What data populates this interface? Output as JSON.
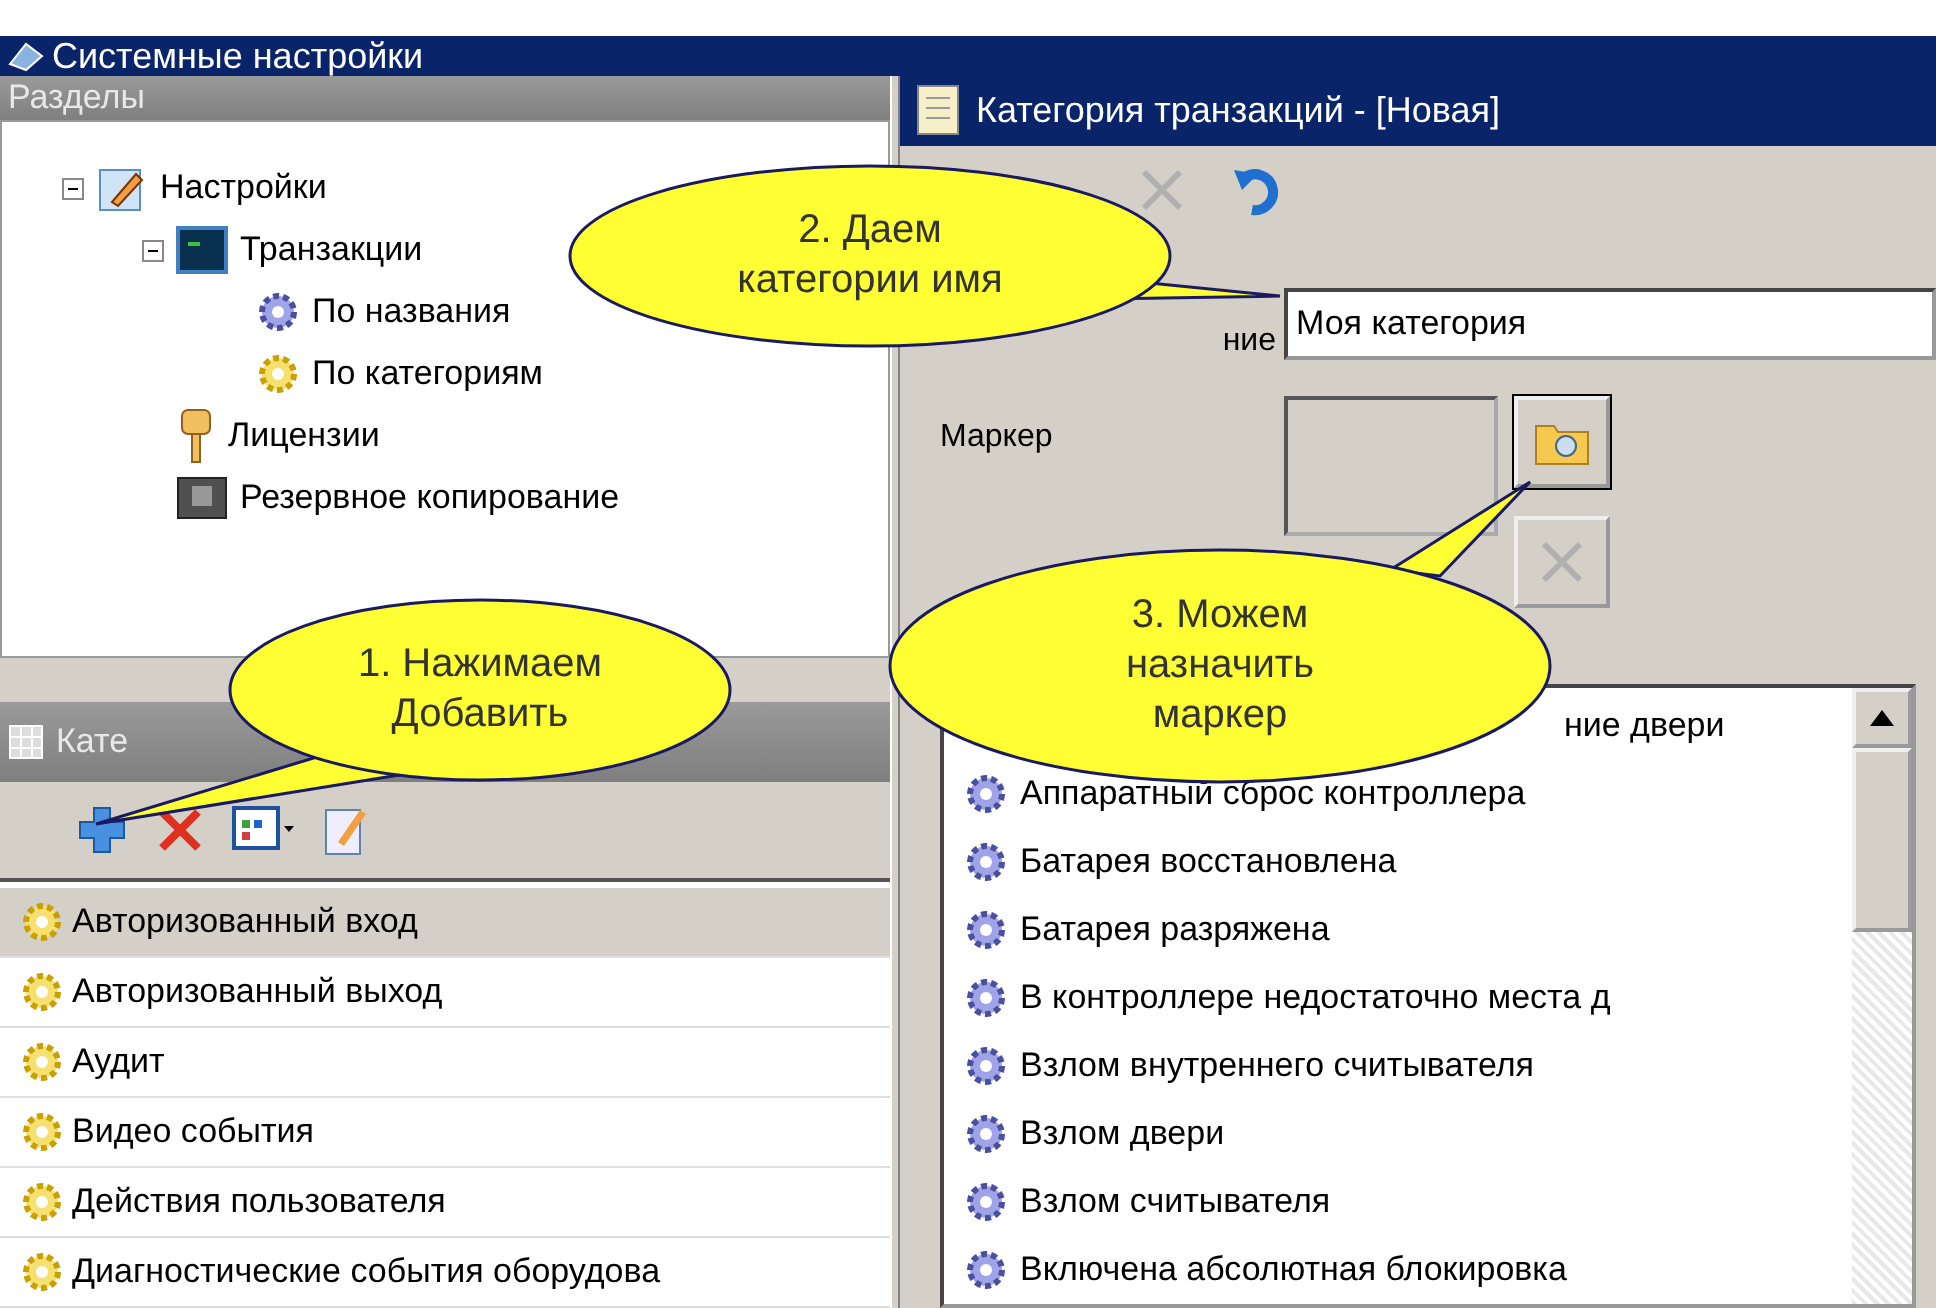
{
  "window": {
    "title": "Системные настройки"
  },
  "sections_panel": {
    "title": "Разделы",
    "tree": [
      {
        "label": "Настройки",
        "kind": "settings",
        "expanded": true,
        "children": [
          {
            "label": "Транзакции",
            "kind": "terminal",
            "expanded": true,
            "children": [
              {
                "label": "По названия",
                "kind": "gear-blue"
              },
              {
                "label": "По категориям",
                "kind": "gear-yellow"
              }
            ]
          },
          {
            "label": "Лицензии",
            "kind": "key"
          },
          {
            "label": "Резервное копирование",
            "kind": "backup"
          }
        ]
      }
    ]
  },
  "categories_panel": {
    "title": "Кате",
    "rows": [
      {
        "label": "Авторизованный вход",
        "selected": true
      },
      {
        "label": "Авторизованный выход",
        "selected": false
      },
      {
        "label": "Аудит",
        "selected": false
      },
      {
        "label": "Видео события",
        "selected": false
      },
      {
        "label": "Действия пользователя",
        "selected": false
      },
      {
        "label": "Диагностические события оборудова",
        "selected": false
      }
    ]
  },
  "editor": {
    "title": "Категория транзакций -  [Новая]",
    "name_label": "ние",
    "name_value": "Моя категория",
    "marker_label": "Маркер",
    "clear_marker": {
      "disabled": true
    },
    "events": [
      {
        "label": "ние двери",
        "kind": "partly-hidden"
      },
      {
        "label": "Аппаратный сброс контроллера",
        "kind": "normal"
      },
      {
        "label": "Батарея восстановлена",
        "kind": "normal"
      },
      {
        "label": "Батарея разряжена",
        "kind": "normal"
      },
      {
        "label": "В контроллере недостаточно места д",
        "kind": "normal"
      },
      {
        "label": "Взлом внутреннего считывателя",
        "kind": "normal"
      },
      {
        "label": "Взлом двери",
        "kind": "normal"
      },
      {
        "label": "Взлом считывателя",
        "kind": "normal"
      },
      {
        "label": "Включена абсолютная блокировка",
        "kind": "normal"
      }
    ]
  },
  "callouts": [
    {
      "lines": [
        "1. Нажимаем",
        "Добавить"
      ]
    },
    {
      "lines": [
        "2. Даем",
        "категории имя"
      ]
    },
    {
      "lines": [
        "3. Можем",
        "назначить",
        "маркер"
      ]
    }
  ]
}
